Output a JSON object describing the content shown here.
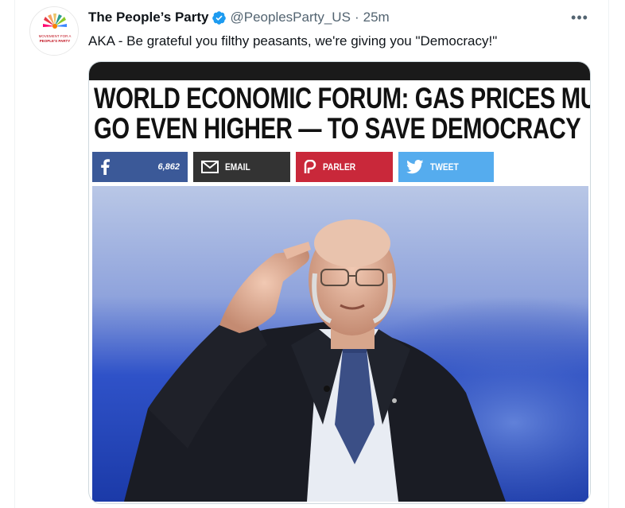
{
  "tweet": {
    "display_name": "The People’s Party",
    "handle": "@PeoplesParty_US",
    "separator": "·",
    "time": "25m",
    "text": "AKA - Be grateful you filthy peasants, we're giving you \"Democracy!\"",
    "more_icon": "•••"
  },
  "avatar": {
    "line1": "MOVEMENT FOR A",
    "line2": "PEOPLE'S PARTY"
  },
  "media": {
    "headline_line1": "WORLD ECONOMIC FORUM: GAS PRICES MUST",
    "headline_line2": "GO EVEN HIGHER — TO SAVE DEMOCRACY",
    "share": {
      "facebook_count": "6,862",
      "email_label": "EMAIL",
      "parler_label": "PARLER",
      "tweet_label": "TWEET"
    }
  },
  "colors": {
    "verified": "#1d9bf0",
    "facebook": "#3b5998",
    "email": "#333333",
    "parler": "#c9283a",
    "twitter": "#55acee"
  }
}
